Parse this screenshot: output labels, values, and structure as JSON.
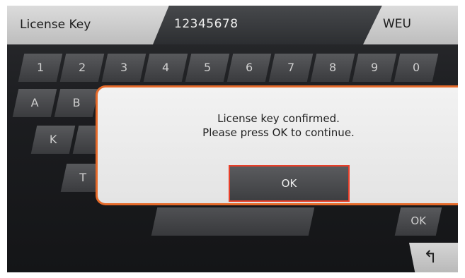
{
  "header": {
    "title": "License Key",
    "key_value": "12345678",
    "region": "WEU"
  },
  "keyboard": {
    "row1": [
      "1",
      "2",
      "3",
      "4",
      "5",
      "6",
      "7",
      "8",
      "9",
      "0"
    ],
    "row2_visible": [
      "A",
      "B"
    ],
    "row3_visible": [
      "K"
    ],
    "row4_visible": [
      "T"
    ],
    "ok_label": "OK",
    "back_glyph": "↰"
  },
  "dialog": {
    "line1": "License key confirmed.",
    "line2": "Please press OK to continue.",
    "ok_label": "OK"
  },
  "colors": {
    "dialog_border": "#e56a2a",
    "ok_highlight": "#e8402a"
  }
}
